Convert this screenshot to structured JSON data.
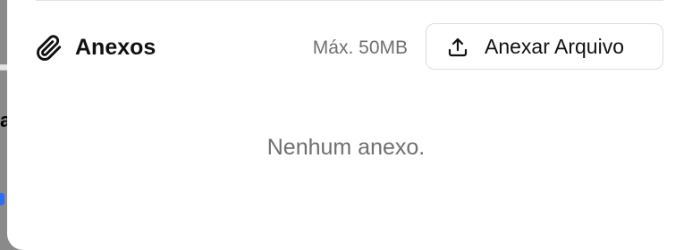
{
  "background": {
    "fragment_text": "a"
  },
  "attachments": {
    "title": "Anexos",
    "max_size": "Máx. 50MB",
    "attach_button_label": "Anexar Arquivo",
    "empty_message": "Nenhum anexo.",
    "icons": {
      "title_icon": "paperclip-icon",
      "button_icon": "upload-icon"
    }
  },
  "colors": {
    "panel_background": "#ffffff",
    "backdrop": "#8a8a8a",
    "muted_text": "#6f6f6f",
    "border": "#dcdcdc",
    "accent_fragment": "#2f6df6"
  }
}
